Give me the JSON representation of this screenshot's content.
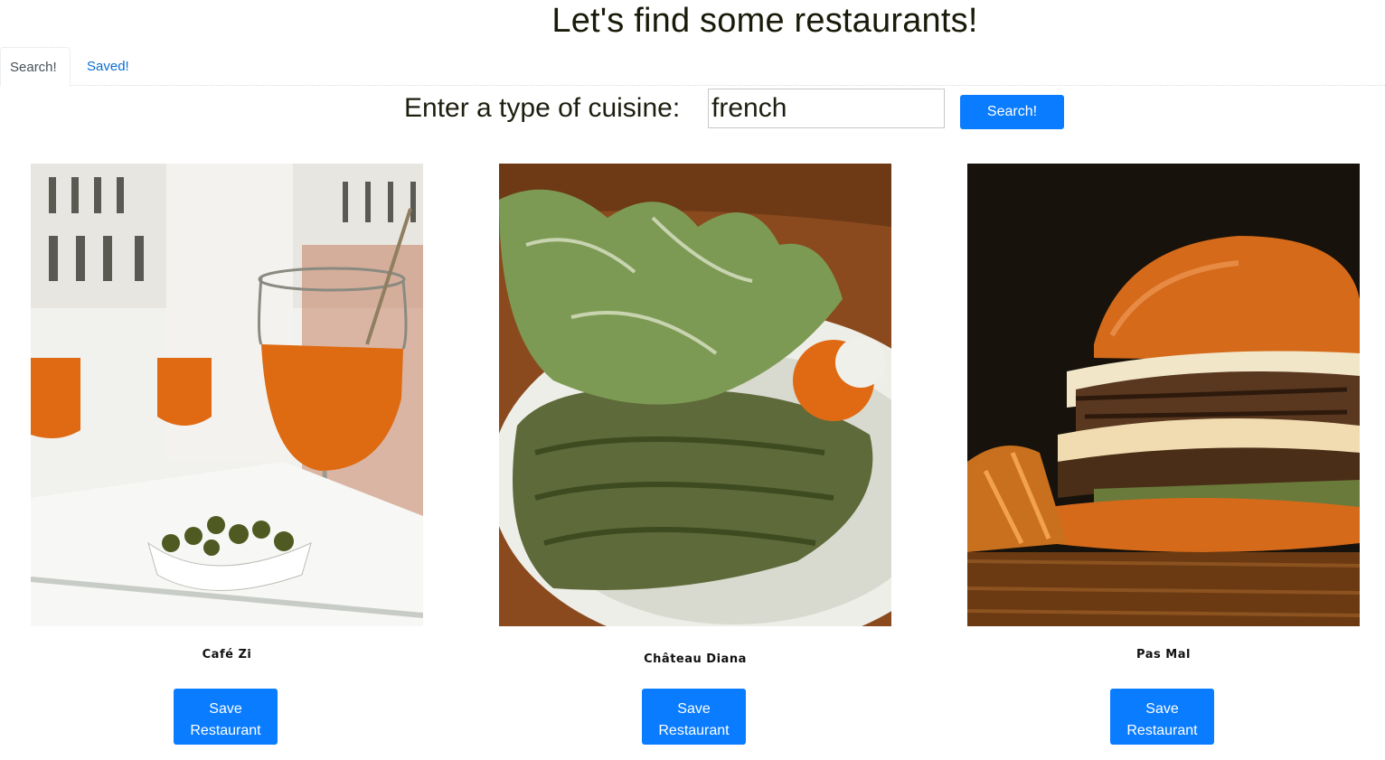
{
  "header": {
    "title": "Let's find some restaurants!"
  },
  "tabs": [
    {
      "label": "Search!",
      "active": true
    },
    {
      "label": "Saved!",
      "active": false
    }
  ],
  "search": {
    "label": "Enter a type of cuisine:",
    "value": "french",
    "button_label": "Search!"
  },
  "restaurants": [
    {
      "name": "Café Zi",
      "image": "cocktail-glasses-olives-photo",
      "save_label": "Save Restaurant"
    },
    {
      "name": "Château Diana",
      "image": "steak-salad-photo",
      "save_label": "Save Restaurant"
    },
    {
      "name": "Pas Mal",
      "image": "double-cheeseburger-photo",
      "save_label": "Save Restaurant"
    }
  ],
  "colors": {
    "accent": "#0a7cff",
    "link": "#0a6ed1",
    "text": "#212529"
  }
}
